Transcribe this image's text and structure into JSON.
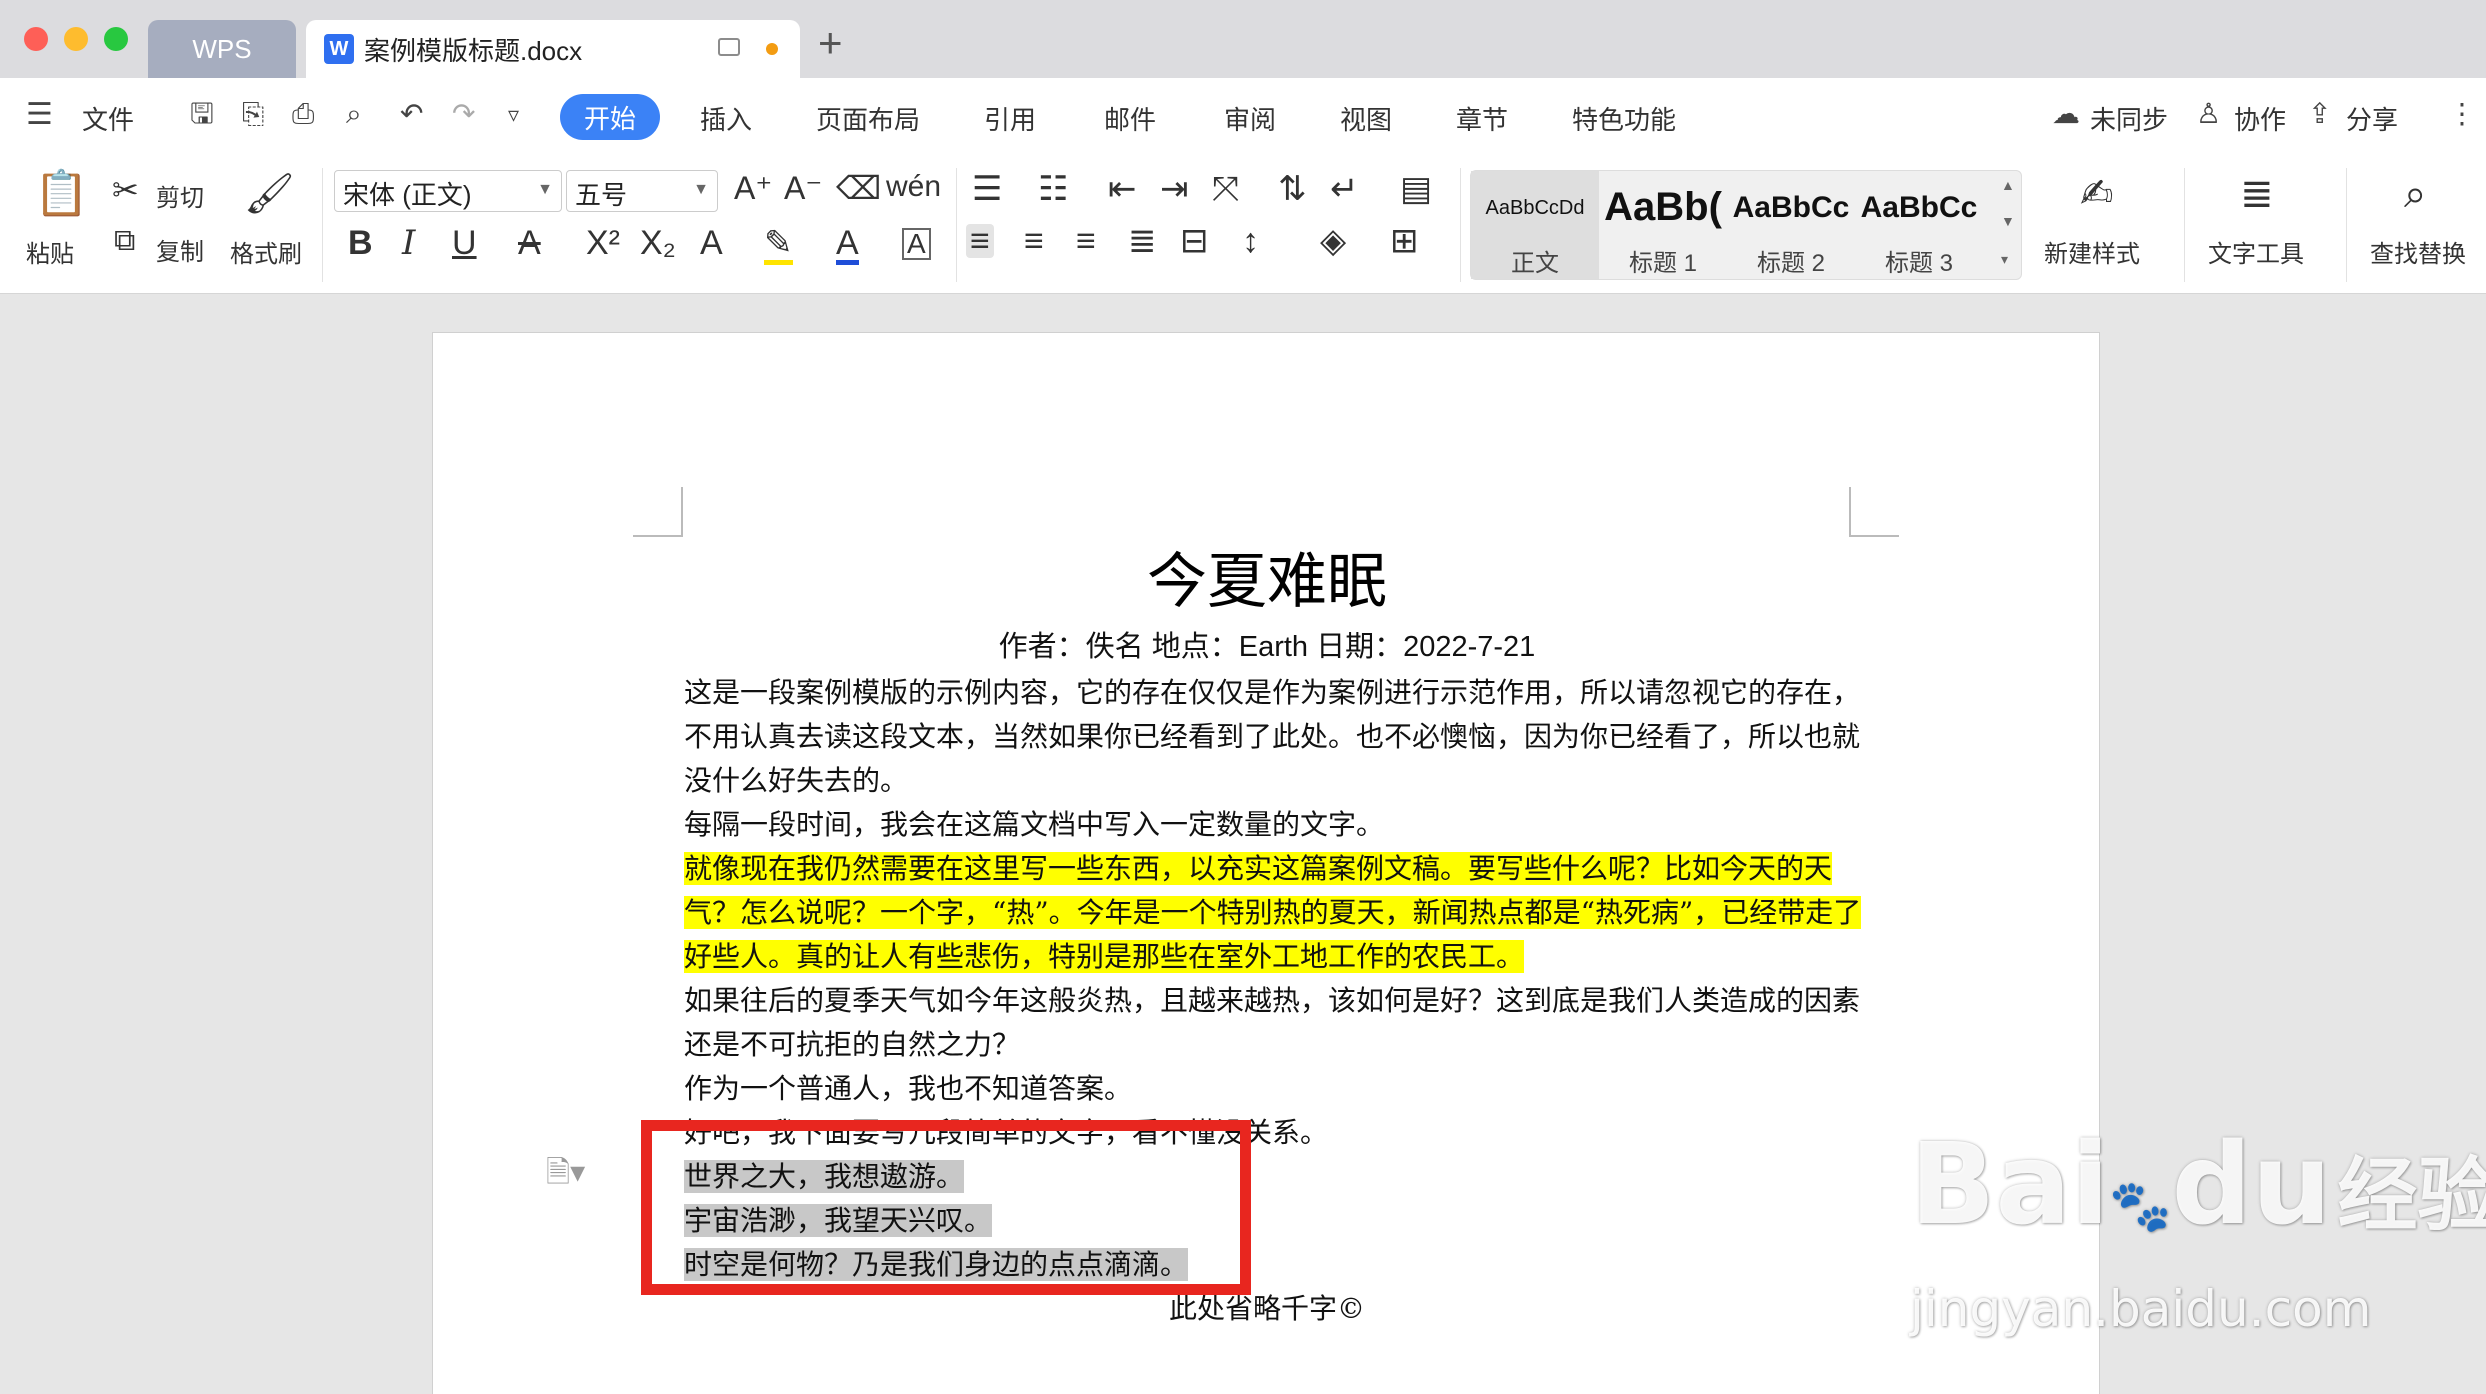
{
  "tabs": {
    "wps": "WPS",
    "document": "案例模版标题.docx"
  },
  "menu": {
    "file": "文件",
    "items": [
      "开始",
      "插入",
      "页面布局",
      "引用",
      "邮件",
      "审阅",
      "视图",
      "章节",
      "特色功能"
    ],
    "unsynced": "未同步",
    "collaborate": "协作",
    "share": "分享"
  },
  "ribbon": {
    "paste": "粘贴",
    "cut": "剪切",
    "copy": "复制",
    "format_painter": "格式刷",
    "font_name": "宋体 (正文)",
    "font_size": "五号",
    "styles": [
      {
        "preview": "AaBbCcDd",
        "name": "正文"
      },
      {
        "preview": "AaBb(",
        "name": "标题 1"
      },
      {
        "preview": "AaBbCc",
        "name": "标题 2"
      },
      {
        "preview": "AaBbCc",
        "name": "标题 3"
      }
    ],
    "new_style": "新建样式",
    "text_tools": "文字工具",
    "find_replace": "查找替换"
  },
  "document": {
    "title": "今夏难眠",
    "meta": "作者：佚名  地点：Earth  日期：2022-7-21",
    "p1": "这是一段案例模版的示例内容，它的存在仅仅是作为案例进行示范作用，所以请忽视它的存在，不用认真去读这段文本，当然如果你已经看到了此处。也不必懊恼，因为你已经看了，所以也就没什么好失去的。",
    "p2": "每隔一段时间，我会在这篇文档中写入一定数量的文字。",
    "p3": "就像现在我仍然需要在这里写一些东西，以充实这篇案例文稿。要写些什么呢？比如今天的天气？怎么说呢？一个字，“热”。今年是一个特别热的夏天，新闻热点都是“热死病”，已经带走了好些人。真的让人有些悲伤，特别是那些在室外工地工作的农民工。",
    "p4": "如果往后的夏季天气如今年这般炎热，且越来越热，该如何是好？这到底是我们人类造成的因素还是不可抗拒的自然之力？",
    "p5": "作为一个普通人，我也不知道答案。",
    "p6": "好吧，我下面要写几段简单的文字，看不懂没关系。",
    "sel1": "世界之大，我想遨游。",
    "sel2": "宇宙浩渺，我望天兴叹。",
    "sel3": "时空是何物？乃是我们身边的点点滴滴。",
    "p7": "此处省略千字©"
  },
  "watermark": {
    "brand": "Bai",
    "brand2": "du",
    "label": "经验",
    "url": "jingyan.baidu.com"
  },
  "colors": {
    "accent": "#3b82f6",
    "highlight": "#ffff00",
    "selection": "#c8c8c8",
    "annotation": "#e8261f"
  }
}
